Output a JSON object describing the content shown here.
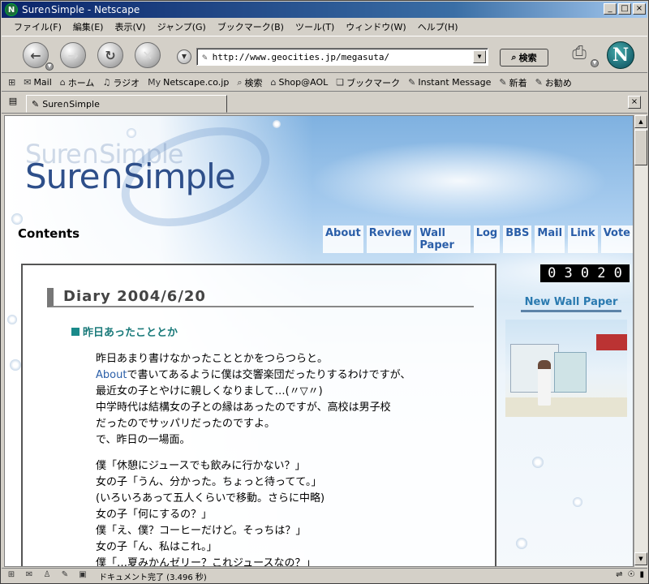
{
  "window": {
    "title": "Sure∩Simple - Netscape",
    "app_icon_letter": "N",
    "minimize": "_",
    "maximize": "□",
    "close": "×"
  },
  "menu": {
    "items": [
      "ファイル(F)",
      "編集(E)",
      "表示(V)",
      "ジャンプ(G)",
      "ブックマーク(B)",
      "ツール(T)",
      "ウィンドウ(W)",
      "ヘルプ(H)"
    ]
  },
  "navbar": {
    "back_glyph": "←",
    "forward_glyph": "→",
    "reload_glyph": "↻",
    "stop_glyph": "✕",
    "url": "http://www.geocities.jp/megasuta/",
    "search_label": "検索",
    "logo_letter": "N"
  },
  "personal_toolbar": {
    "items": [
      {
        "label": "Mail",
        "icon": "mail-icon",
        "glyph": "✉"
      },
      {
        "label": "ホーム",
        "icon": "home-icon",
        "glyph": "⌂"
      },
      {
        "label": "ラジオ",
        "icon": "radio-icon",
        "glyph": "♫"
      },
      {
        "label": "Netscape.co.jp",
        "icon": "my-icon",
        "glyph": "My"
      },
      {
        "label": "検索",
        "icon": "search-icon",
        "glyph": "⌕"
      },
      {
        "label": "Shop@AOL",
        "icon": "shop-icon",
        "glyph": "⌂"
      },
      {
        "label": "ブックマーク",
        "icon": "bookmark-icon",
        "glyph": "❏"
      },
      {
        "label": "Instant Message",
        "icon": "im-icon",
        "glyph": "✎"
      },
      {
        "label": "新着",
        "icon": "new-icon",
        "glyph": "✎"
      },
      {
        "label": "お勧め",
        "icon": "recommend-icon",
        "glyph": "✎"
      }
    ]
  },
  "tab": {
    "label": "Sure∩Simple",
    "close": "×"
  },
  "page": {
    "logo_text": "Sure∩Simple",
    "contents_title": "Contents",
    "nav_links": [
      "About",
      "Review",
      "Wall Paper",
      "Log",
      "BBS",
      "Mail",
      "Link",
      "Vote"
    ],
    "counter_digits": [
      "0",
      "3",
      "0",
      "2",
      "0"
    ],
    "new_wallpaper": "New Wall Paper",
    "diary_title": "Diary  2004/6/20",
    "subhead": "昨日あったこととか",
    "para1": {
      "line1": "昨日あまり書けなかったこととかをつらつらと。",
      "line2_link": "About",
      "line2_rest": "で書いてあるように僕は交響楽団だったりするわけですが、",
      "line3": "最近女の子とやけに親しくなりまして…(〃▽〃)",
      "line4": "中学時代は結構女の子との縁はあったのですが、高校は男子校",
      "line5": "だったのでサッパリだったのですよ。",
      "line6": "で、昨日の一場面。"
    },
    "para2": [
      "僕「休憩にジュースでも飲みに行かない？」",
      "女の子「うん、分かった。ちょっと待ってて。」",
      "(いろいろあって五人くらいで移動。さらに中略)",
      "女の子「何にするの？」",
      "僕「え、僕？コーヒーだけど。そっちは？」",
      "女の子「ん、私はこれ。」",
      "僕「…夏みかんゼリー？これジュースなの？」"
    ]
  },
  "status": {
    "text": "ドキュメント完了 (3.496 秒)"
  },
  "colors": {
    "link": "#2a5ea8",
    "subhead": "#1a7a7a",
    "title_bar": "#0a246a"
  }
}
